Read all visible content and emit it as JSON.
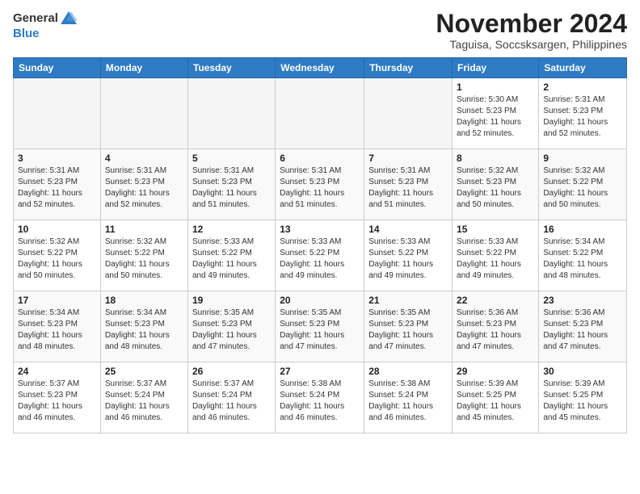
{
  "header": {
    "logo_general": "General",
    "logo_blue": "Blue",
    "month_title": "November 2024",
    "location": "Taguisa, Soccsksargen, Philippines"
  },
  "weekdays": [
    "Sunday",
    "Monday",
    "Tuesday",
    "Wednesday",
    "Thursday",
    "Friday",
    "Saturday"
  ],
  "weeks": [
    [
      {
        "day": "",
        "info": ""
      },
      {
        "day": "",
        "info": ""
      },
      {
        "day": "",
        "info": ""
      },
      {
        "day": "",
        "info": ""
      },
      {
        "day": "",
        "info": ""
      },
      {
        "day": "1",
        "info": "Sunrise: 5:30 AM\nSunset: 5:23 PM\nDaylight: 11 hours\nand 52 minutes."
      },
      {
        "day": "2",
        "info": "Sunrise: 5:31 AM\nSunset: 5:23 PM\nDaylight: 11 hours\nand 52 minutes."
      }
    ],
    [
      {
        "day": "3",
        "info": "Sunrise: 5:31 AM\nSunset: 5:23 PM\nDaylight: 11 hours\nand 52 minutes."
      },
      {
        "day": "4",
        "info": "Sunrise: 5:31 AM\nSunset: 5:23 PM\nDaylight: 11 hours\nand 52 minutes."
      },
      {
        "day": "5",
        "info": "Sunrise: 5:31 AM\nSunset: 5:23 PM\nDaylight: 11 hours\nand 51 minutes."
      },
      {
        "day": "6",
        "info": "Sunrise: 5:31 AM\nSunset: 5:23 PM\nDaylight: 11 hours\nand 51 minutes."
      },
      {
        "day": "7",
        "info": "Sunrise: 5:31 AM\nSunset: 5:23 PM\nDaylight: 11 hours\nand 51 minutes."
      },
      {
        "day": "8",
        "info": "Sunrise: 5:32 AM\nSunset: 5:23 PM\nDaylight: 11 hours\nand 50 minutes."
      },
      {
        "day": "9",
        "info": "Sunrise: 5:32 AM\nSunset: 5:22 PM\nDaylight: 11 hours\nand 50 minutes."
      }
    ],
    [
      {
        "day": "10",
        "info": "Sunrise: 5:32 AM\nSunset: 5:22 PM\nDaylight: 11 hours\nand 50 minutes."
      },
      {
        "day": "11",
        "info": "Sunrise: 5:32 AM\nSunset: 5:22 PM\nDaylight: 11 hours\nand 50 minutes."
      },
      {
        "day": "12",
        "info": "Sunrise: 5:33 AM\nSunset: 5:22 PM\nDaylight: 11 hours\nand 49 minutes."
      },
      {
        "day": "13",
        "info": "Sunrise: 5:33 AM\nSunset: 5:22 PM\nDaylight: 11 hours\nand 49 minutes."
      },
      {
        "day": "14",
        "info": "Sunrise: 5:33 AM\nSunset: 5:22 PM\nDaylight: 11 hours\nand 49 minutes."
      },
      {
        "day": "15",
        "info": "Sunrise: 5:33 AM\nSunset: 5:22 PM\nDaylight: 11 hours\nand 49 minutes."
      },
      {
        "day": "16",
        "info": "Sunrise: 5:34 AM\nSunset: 5:22 PM\nDaylight: 11 hours\nand 48 minutes."
      }
    ],
    [
      {
        "day": "17",
        "info": "Sunrise: 5:34 AM\nSunset: 5:23 PM\nDaylight: 11 hours\nand 48 minutes."
      },
      {
        "day": "18",
        "info": "Sunrise: 5:34 AM\nSunset: 5:23 PM\nDaylight: 11 hours\nand 48 minutes."
      },
      {
        "day": "19",
        "info": "Sunrise: 5:35 AM\nSunset: 5:23 PM\nDaylight: 11 hours\nand 47 minutes."
      },
      {
        "day": "20",
        "info": "Sunrise: 5:35 AM\nSunset: 5:23 PM\nDaylight: 11 hours\nand 47 minutes."
      },
      {
        "day": "21",
        "info": "Sunrise: 5:35 AM\nSunset: 5:23 PM\nDaylight: 11 hours\nand 47 minutes."
      },
      {
        "day": "22",
        "info": "Sunrise: 5:36 AM\nSunset: 5:23 PM\nDaylight: 11 hours\nand 47 minutes."
      },
      {
        "day": "23",
        "info": "Sunrise: 5:36 AM\nSunset: 5:23 PM\nDaylight: 11 hours\nand 47 minutes."
      }
    ],
    [
      {
        "day": "24",
        "info": "Sunrise: 5:37 AM\nSunset: 5:23 PM\nDaylight: 11 hours\nand 46 minutes."
      },
      {
        "day": "25",
        "info": "Sunrise: 5:37 AM\nSunset: 5:24 PM\nDaylight: 11 hours\nand 46 minutes."
      },
      {
        "day": "26",
        "info": "Sunrise: 5:37 AM\nSunset: 5:24 PM\nDaylight: 11 hours\nand 46 minutes."
      },
      {
        "day": "27",
        "info": "Sunrise: 5:38 AM\nSunset: 5:24 PM\nDaylight: 11 hours\nand 46 minutes."
      },
      {
        "day": "28",
        "info": "Sunrise: 5:38 AM\nSunset: 5:24 PM\nDaylight: 11 hours\nand 46 minutes."
      },
      {
        "day": "29",
        "info": "Sunrise: 5:39 AM\nSunset: 5:25 PM\nDaylight: 11 hours\nand 45 minutes."
      },
      {
        "day": "30",
        "info": "Sunrise: 5:39 AM\nSunset: 5:25 PM\nDaylight: 11 hours\nand 45 minutes."
      }
    ]
  ]
}
